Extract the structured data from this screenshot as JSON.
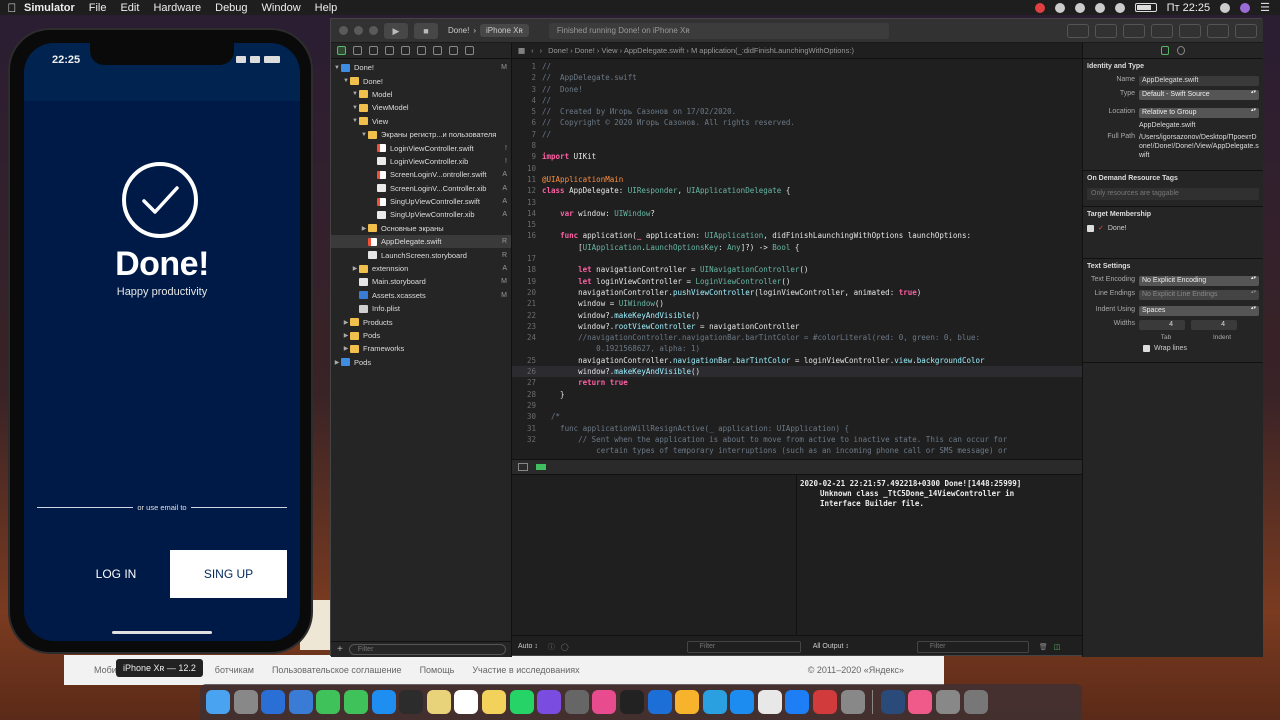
{
  "menubar": {
    "apple": "",
    "items": [
      "Simulator",
      "File",
      "Edit",
      "Hardware",
      "Debug",
      "Window",
      "Help"
    ],
    "clock": "Пт 22:25"
  },
  "browser": {
    "links": [
      "Моби",
      "ботчикам",
      "Пользовательское соглашение",
      "Помощь",
      "Участие в исследованиях"
    ],
    "copyright": "© 2011–2020 «Яндекс»"
  },
  "xcode": {
    "toolbar": {
      "scheme": "Done!",
      "device": "iPhone Xʀ",
      "status": "Finished running Done! on iPhone Xʀ"
    },
    "navigator": {
      "items": [
        {
          "label": "Done!",
          "depth": 0,
          "icon": "proj",
          "open": true,
          "badge": "M"
        },
        {
          "label": "Done!",
          "depth": 1,
          "icon": "folder",
          "open": true,
          "badge": ""
        },
        {
          "label": "Model",
          "depth": 2,
          "icon": "folder",
          "open": true,
          "badge": ""
        },
        {
          "label": "ViewModel",
          "depth": 2,
          "icon": "folder",
          "open": true,
          "badge": ""
        },
        {
          "label": "View",
          "depth": 2,
          "icon": "folder",
          "open": true,
          "badge": ""
        },
        {
          "label": "Экраны регистр...и пользователя",
          "depth": 3,
          "icon": "folder",
          "open": true,
          "badge": ""
        },
        {
          "label": "LoginViewController.swift",
          "depth": 4,
          "icon": "swift",
          "open": null,
          "badge": "!"
        },
        {
          "label": "LoginViewController.xib",
          "depth": 4,
          "icon": "xib",
          "open": null,
          "badge": "!"
        },
        {
          "label": "ScreenLoginV...ontroller.swift",
          "depth": 4,
          "icon": "swift",
          "open": null,
          "badge": "A"
        },
        {
          "label": "ScreenLoginV...Controller.xib",
          "depth": 4,
          "icon": "xib",
          "open": null,
          "badge": "A"
        },
        {
          "label": "SingUpViewController.swift",
          "depth": 4,
          "icon": "swift",
          "open": null,
          "badge": "A"
        },
        {
          "label": "SingUpViewController.xib",
          "depth": 4,
          "icon": "xib",
          "open": null,
          "badge": "A"
        },
        {
          "label": "Основные экраны",
          "depth": 3,
          "icon": "folder",
          "open": false,
          "badge": ""
        },
        {
          "label": "AppDelegate.swift",
          "depth": 3,
          "icon": "swift",
          "open": null,
          "badge": "R",
          "selected": true
        },
        {
          "label": "LaunchScreen.storyboard",
          "depth": 3,
          "icon": "sb",
          "open": null,
          "badge": "R"
        },
        {
          "label": "extennsion",
          "depth": 2,
          "icon": "folder",
          "open": false,
          "badge": "A"
        },
        {
          "label": "Main.storyboard",
          "depth": 2,
          "icon": "sb",
          "open": null,
          "badge": "M"
        },
        {
          "label": "Assets.xcassets",
          "depth": 2,
          "icon": "assets",
          "open": null,
          "badge": "M"
        },
        {
          "label": "Info.plist",
          "depth": 2,
          "icon": "plist",
          "open": null,
          "badge": ""
        },
        {
          "label": "Products",
          "depth": 1,
          "icon": "folder",
          "open": false,
          "badge": ""
        },
        {
          "label": "Pods",
          "depth": 1,
          "icon": "folder",
          "open": false,
          "badge": ""
        },
        {
          "label": "Frameworks",
          "depth": 1,
          "icon": "folder",
          "open": false,
          "badge": ""
        },
        {
          "label": "Pods",
          "depth": 0,
          "icon": "proj",
          "open": false,
          "badge": ""
        }
      ],
      "filter_placeholder": "Filter"
    },
    "jumpbar": "Done!  ›  Done!  ›  View  ›  AppDelegate.swift  ›  M  application(_:didFinishLaunchingWithOptions:)",
    "code": [
      {
        "n": "1",
        "html": "<span class='cm'>//</span>"
      },
      {
        "n": "2",
        "html": "<span class='cm'>//  AppDelegate.swift</span>"
      },
      {
        "n": "3",
        "html": "<span class='cm'>//  Done!</span>"
      },
      {
        "n": "4",
        "html": "<span class='cm'>//</span>"
      },
      {
        "n": "5",
        "html": "<span class='cm'>//  Created by Игорь Сазонов on 17/02/2020.</span>"
      },
      {
        "n": "6",
        "html": "<span class='cm'>//  Copyright © 2020 Игорь Сазонов. All rights reserved.</span>"
      },
      {
        "n": "7",
        "html": "<span class='cm'>//</span>"
      },
      {
        "n": "8",
        "html": ""
      },
      {
        "n": "9",
        "html": "<span class='kw'>import</span> UIKit"
      },
      {
        "n": "10",
        "html": ""
      },
      {
        "n": "11",
        "html": "<span class='at'>@UIApplicationMain</span>"
      },
      {
        "n": "12",
        "html": "<span class='kw'>class</span> AppDelegate: <span class='ty'>UIResponder</span>, <span class='ty'>UIApplicationDelegate</span> {"
      },
      {
        "n": "13",
        "html": ""
      },
      {
        "n": "14",
        "html": "    <span class='kw'>var</span> window: <span class='ty'>UIWindow</span>?"
      },
      {
        "n": "15",
        "html": ""
      },
      {
        "n": "16",
        "html": "    <span class='kw'>func</span> application(<span class='kw'>_</span> application: <span class='ty'>UIApplication</span>, didFinishLaunchingWithOptions launchOptions:"
      },
      {
        "n": "",
        "html": "        [<span class='ty'>UIApplication</span>.<span class='ty'>LaunchOptionsKey</span>: <span class='ty'>Any</span>]?) -> <span class='ty'>Bool</span> {"
      },
      {
        "n": "17",
        "html": ""
      },
      {
        "n": "18",
        "html": "        <span class='kw'>let</span> navigationController = <span class='ty'>UINavigationController</span>()"
      },
      {
        "n": "19",
        "html": "        <span class='kw'>let</span> loginViewController = <span class='ty'>LoginViewController</span>()"
      },
      {
        "n": "20",
        "html": "        navigationController.<span class='mth'>pushViewController</span>(loginViewController, animated: <span class='kw'>true</span>)"
      },
      {
        "n": "21",
        "html": "        window = <span class='ty'>UIWindow</span>()"
      },
      {
        "n": "22",
        "html": "        window?.<span class='mth'>makeKeyAndVisible</span>()"
      },
      {
        "n": "23",
        "html": "        window?.<span class='mth'>rootViewController</span> = navigationController"
      },
      {
        "n": "24",
        "html": "        <span class='cm'>//navigationController.navigationBar.barTintColor = #colorLiteral(red: 0, green: 0, blue:</span>"
      },
      {
        "n": "",
        "html": "<span class='cm'>            0.1921568627, alpha: 1)</span>"
      },
      {
        "n": "25",
        "html": "        navigationController.<span class='mth'>navigationBar</span>.<span class='mth'>barTintColor</span> = loginViewController.<span class='mth'>view</span>.<span class='mth'>backgroundColor</span>"
      },
      {
        "n": "26",
        "html": "        window?.<span class='mth'>makeKeyAndVisible</span>()",
        "current": true
      },
      {
        "n": "27",
        "html": "        <span class='kw'>return</span> <span class='kw'>true</span>"
      },
      {
        "n": "28",
        "html": "    }"
      },
      {
        "n": "29",
        "html": ""
      },
      {
        "n": "30",
        "html": "  <span class='cm'>/*</span>"
      },
      {
        "n": "31",
        "html": "<span class='cm'>    func applicationWillResignActive(_ application: UIApplication) {</span>"
      },
      {
        "n": "32",
        "html": "<span class='cm'>        // Sent when the application is about to move from active to inactive state. This can occur for</span>"
      },
      {
        "n": "",
        "html": "<span class='cm'>            certain types of temporary interruptions (such as an incoming phone call or SMS message) or</span>"
      }
    ],
    "console": {
      "line1": "2020-02-21 22:21:57.492218+0300 Done![1448:25999]",
      "line2": "Unknown class _TtC5Done_14ViewController in",
      "line3": "Interface Builder file."
    },
    "bottombar": {
      "auto": "Auto ↕",
      "filter": "Filter",
      "all_output": "All Output ↕",
      "filter2": "Filter"
    },
    "inspector": {
      "identity_title": "Identity and Type",
      "name_label": "Name",
      "name_value": "AppDelegate.swift",
      "type_label": "Type",
      "type_value": "Default - Swift Source",
      "location_label": "Location",
      "location_value": "Relative to Group",
      "location_file": "AppDelegate.swift",
      "fullpath_label": "Full Path",
      "fullpath_value": "/Users/igorsazonov/Desktop/ПроектDone!/Done!/Done!/View/AppDelegate.swift",
      "odr_title": "On Demand Resource Tags",
      "odr_placeholder": "Only resources are taggable",
      "target_title": "Target Membership",
      "target_item": "Done!",
      "text_title": "Text Settings",
      "encoding_label": "Text Encoding",
      "encoding_value": "No Explicit Encoding",
      "lineendings_label": "Line Endings",
      "lineendings_value": "No Explicit Line Endings",
      "indent_label": "Indent Using",
      "indent_value": "Spaces",
      "widths_label": "Widths",
      "tab_value": "4",
      "indent_width_value": "4",
      "tab_caption": "Tab",
      "indent_caption": "Indent",
      "wrap_label": "Wrap lines"
    }
  },
  "simulator": {
    "time": "22:25",
    "title": "Done!",
    "subtitle": "Happy productivity",
    "or_text": "or use email to",
    "login": "LOG IN",
    "signup": "SING UP",
    "device_label": "iPhone Xʀ — 12.2",
    "bg_color": "#001a47"
  },
  "dock": {
    "apps": [
      "finder",
      "launchpad",
      "vpn",
      "browser",
      "messages",
      "facetime",
      "appstore",
      "topnotch",
      "notes",
      "calendar",
      "stickies",
      "whatsapp",
      "viber",
      "help",
      "lens",
      "terminal",
      "maps",
      "sketch",
      "telegram",
      "xcode",
      "chrome",
      "safari",
      "acrobat",
      "colorsync",
      "preview",
      "itunes",
      "preferences",
      "trash"
    ]
  }
}
